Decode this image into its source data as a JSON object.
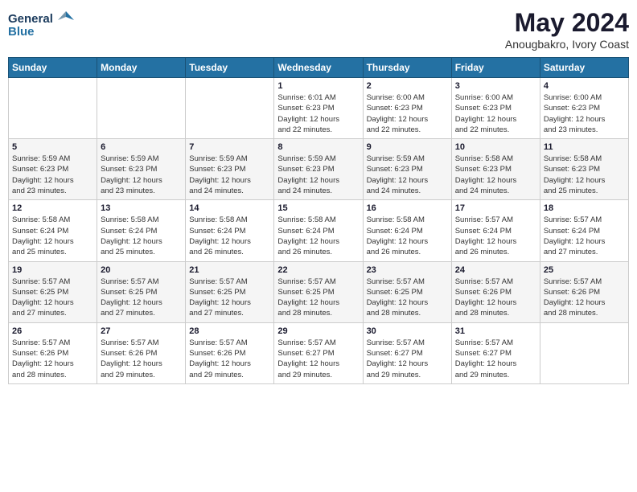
{
  "header": {
    "logo_line1": "General",
    "logo_line2": "Blue",
    "month_year": "May 2024",
    "location": "Anougbakro, Ivory Coast"
  },
  "weekdays": [
    "Sunday",
    "Monday",
    "Tuesday",
    "Wednesday",
    "Thursday",
    "Friday",
    "Saturday"
  ],
  "weeks": [
    [
      {
        "day": "",
        "info": ""
      },
      {
        "day": "",
        "info": ""
      },
      {
        "day": "",
        "info": ""
      },
      {
        "day": "1",
        "info": "Sunrise: 6:01 AM\nSunset: 6:23 PM\nDaylight: 12 hours\nand 22 minutes."
      },
      {
        "day": "2",
        "info": "Sunrise: 6:00 AM\nSunset: 6:23 PM\nDaylight: 12 hours\nand 22 minutes."
      },
      {
        "day": "3",
        "info": "Sunrise: 6:00 AM\nSunset: 6:23 PM\nDaylight: 12 hours\nand 22 minutes."
      },
      {
        "day": "4",
        "info": "Sunrise: 6:00 AM\nSunset: 6:23 PM\nDaylight: 12 hours\nand 23 minutes."
      }
    ],
    [
      {
        "day": "5",
        "info": "Sunrise: 5:59 AM\nSunset: 6:23 PM\nDaylight: 12 hours\nand 23 minutes."
      },
      {
        "day": "6",
        "info": "Sunrise: 5:59 AM\nSunset: 6:23 PM\nDaylight: 12 hours\nand 23 minutes."
      },
      {
        "day": "7",
        "info": "Sunrise: 5:59 AM\nSunset: 6:23 PM\nDaylight: 12 hours\nand 24 minutes."
      },
      {
        "day": "8",
        "info": "Sunrise: 5:59 AM\nSunset: 6:23 PM\nDaylight: 12 hours\nand 24 minutes."
      },
      {
        "day": "9",
        "info": "Sunrise: 5:59 AM\nSunset: 6:23 PM\nDaylight: 12 hours\nand 24 minutes."
      },
      {
        "day": "10",
        "info": "Sunrise: 5:58 AM\nSunset: 6:23 PM\nDaylight: 12 hours\nand 24 minutes."
      },
      {
        "day": "11",
        "info": "Sunrise: 5:58 AM\nSunset: 6:23 PM\nDaylight: 12 hours\nand 25 minutes."
      }
    ],
    [
      {
        "day": "12",
        "info": "Sunrise: 5:58 AM\nSunset: 6:24 PM\nDaylight: 12 hours\nand 25 minutes."
      },
      {
        "day": "13",
        "info": "Sunrise: 5:58 AM\nSunset: 6:24 PM\nDaylight: 12 hours\nand 25 minutes."
      },
      {
        "day": "14",
        "info": "Sunrise: 5:58 AM\nSunset: 6:24 PM\nDaylight: 12 hours\nand 26 minutes."
      },
      {
        "day": "15",
        "info": "Sunrise: 5:58 AM\nSunset: 6:24 PM\nDaylight: 12 hours\nand 26 minutes."
      },
      {
        "day": "16",
        "info": "Sunrise: 5:58 AM\nSunset: 6:24 PM\nDaylight: 12 hours\nand 26 minutes."
      },
      {
        "day": "17",
        "info": "Sunrise: 5:57 AM\nSunset: 6:24 PM\nDaylight: 12 hours\nand 26 minutes."
      },
      {
        "day": "18",
        "info": "Sunrise: 5:57 AM\nSunset: 6:24 PM\nDaylight: 12 hours\nand 27 minutes."
      }
    ],
    [
      {
        "day": "19",
        "info": "Sunrise: 5:57 AM\nSunset: 6:25 PM\nDaylight: 12 hours\nand 27 minutes."
      },
      {
        "day": "20",
        "info": "Sunrise: 5:57 AM\nSunset: 6:25 PM\nDaylight: 12 hours\nand 27 minutes."
      },
      {
        "day": "21",
        "info": "Sunrise: 5:57 AM\nSunset: 6:25 PM\nDaylight: 12 hours\nand 27 minutes."
      },
      {
        "day": "22",
        "info": "Sunrise: 5:57 AM\nSunset: 6:25 PM\nDaylight: 12 hours\nand 28 minutes."
      },
      {
        "day": "23",
        "info": "Sunrise: 5:57 AM\nSunset: 6:25 PM\nDaylight: 12 hours\nand 28 minutes."
      },
      {
        "day": "24",
        "info": "Sunrise: 5:57 AM\nSunset: 6:26 PM\nDaylight: 12 hours\nand 28 minutes."
      },
      {
        "day": "25",
        "info": "Sunrise: 5:57 AM\nSunset: 6:26 PM\nDaylight: 12 hours\nand 28 minutes."
      }
    ],
    [
      {
        "day": "26",
        "info": "Sunrise: 5:57 AM\nSunset: 6:26 PM\nDaylight: 12 hours\nand 28 minutes."
      },
      {
        "day": "27",
        "info": "Sunrise: 5:57 AM\nSunset: 6:26 PM\nDaylight: 12 hours\nand 29 minutes."
      },
      {
        "day": "28",
        "info": "Sunrise: 5:57 AM\nSunset: 6:26 PM\nDaylight: 12 hours\nand 29 minutes."
      },
      {
        "day": "29",
        "info": "Sunrise: 5:57 AM\nSunset: 6:27 PM\nDaylight: 12 hours\nand 29 minutes."
      },
      {
        "day": "30",
        "info": "Sunrise: 5:57 AM\nSunset: 6:27 PM\nDaylight: 12 hours\nand 29 minutes."
      },
      {
        "day": "31",
        "info": "Sunrise: 5:57 AM\nSunset: 6:27 PM\nDaylight: 12 hours\nand 29 minutes."
      },
      {
        "day": "",
        "info": ""
      }
    ]
  ]
}
